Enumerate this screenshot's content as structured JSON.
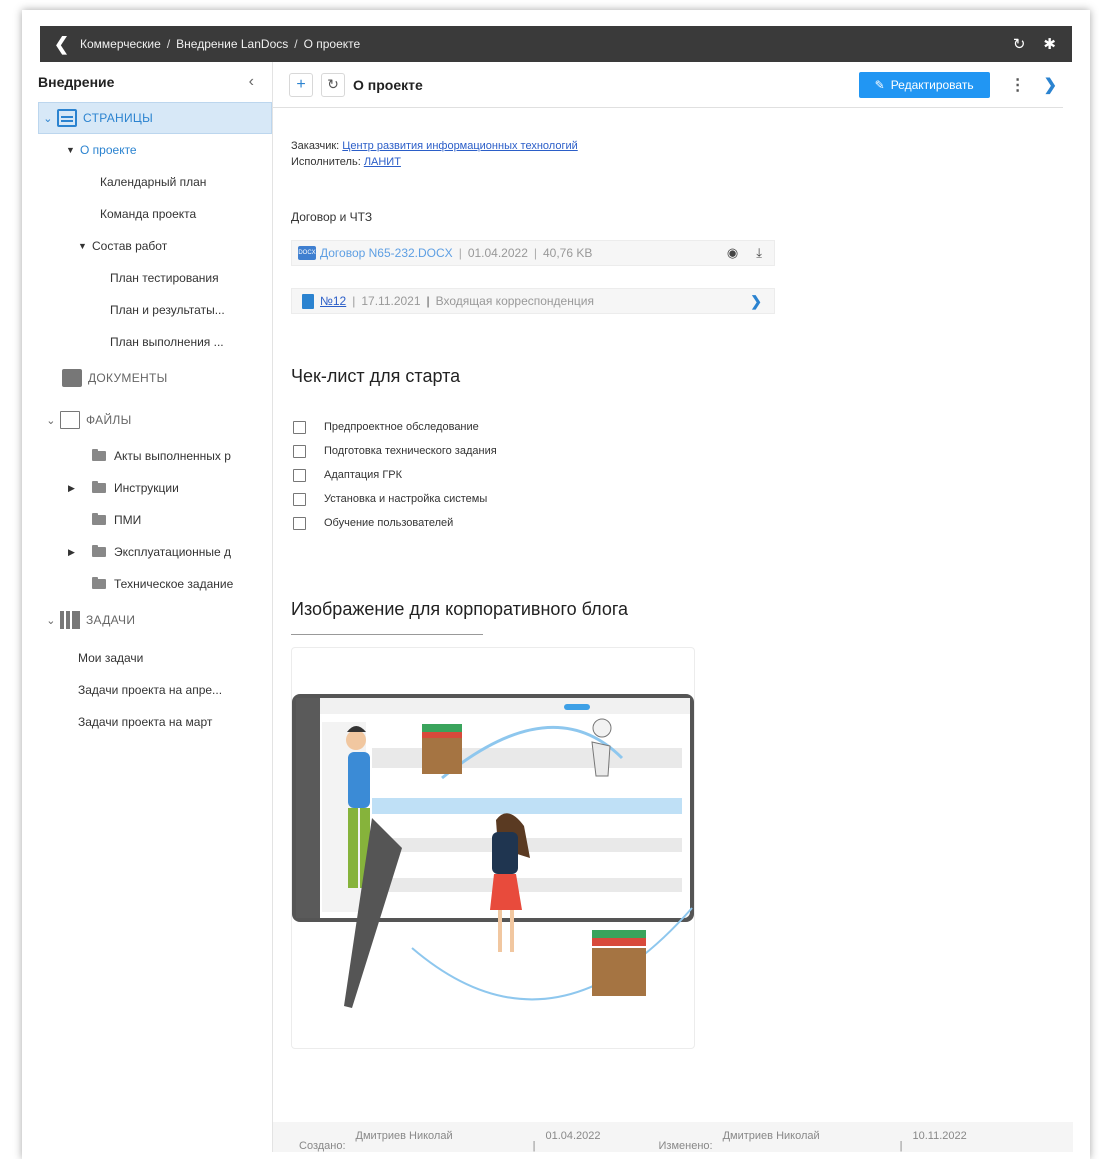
{
  "breadcrumb": {
    "items": [
      "Коммерческие",
      "Внедрение LanDocs",
      "О проекте"
    ],
    "separator": "/"
  },
  "sidebar": {
    "title": "Внедрение",
    "sections": {
      "pages": "СТРАНИЦЫ",
      "documents": "ДОКУМЕНТЫ",
      "files": "ФАЙЛЫ",
      "tasks": "ЗАДАЧИ"
    },
    "pages": {
      "about": "О проекте",
      "calendar": "Календарный план",
      "team": "Команда проекта",
      "works": "Состав работ",
      "test_plan": "План тестирования",
      "results_plan": "План и результаты...",
      "exec_plan": "План выполнения ..."
    },
    "files": [
      "Акты выполненных р",
      "Инструкции",
      "ПМИ",
      "Эксплуатационные д",
      "Техническое задание"
    ],
    "tasks": [
      "Мои задачи",
      "Задачи проекта на апре...",
      "Задачи проекта на март"
    ]
  },
  "toolbar": {
    "title": "О проекте",
    "edit_label": "Редактировать"
  },
  "content": {
    "customer_label": "Заказчик:",
    "customer": "Центр развития информационных технологий",
    "executor_label": "Исполнитель:",
    "executor": "ЛАНИТ",
    "contract_heading": "Договор и ЧТЗ",
    "attachment": {
      "name": "Договор N65-232.DOCX",
      "date": "01.04.2022",
      "size": "40,76 KB",
      "sep": "|"
    },
    "correspondence": {
      "num": "№12",
      "date": "17.11.2021",
      "type": "Входящая корреспонденция",
      "sep": "|"
    },
    "checklist_title": "Чек-лист для старта",
    "checklist": [
      "Предпроектное обследование",
      "Подготовка технического задания",
      "Адаптация ГРК",
      "Установка и настройка системы",
      "Обучение пользователей"
    ],
    "image_title": "Изображение для корпоративного блога"
  },
  "footer": {
    "created_label": "Создано:",
    "created_by": "Дмитриев Николай",
    "created_date": "01.04.2022",
    "modified_label": "Изменено:",
    "modified_by": "Дмитриев Николай",
    "modified_date": "10.11.2022",
    "sep": "|"
  }
}
